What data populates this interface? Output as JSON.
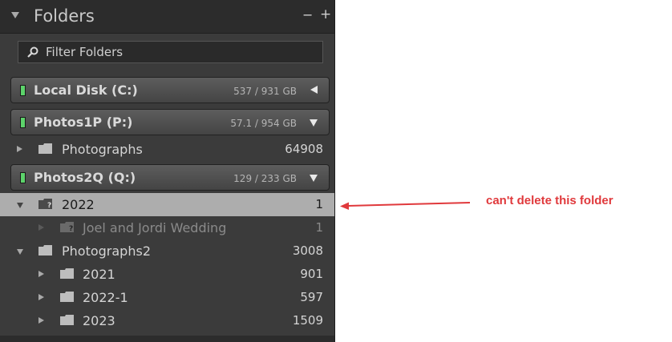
{
  "panel": {
    "title": "Folders",
    "minus_symbol": "−",
    "plus_symbol": "+",
    "filter_placeholder": "Filter Folders"
  },
  "volumes": [
    {
      "name": "Local Disk (C:)",
      "size": "537 / 931 GB",
      "led_color": "#5dd36b",
      "state": "collapsed"
    },
    {
      "name": "Photos1P (P:)",
      "size": "57.1 / 954 GB",
      "led_color": "#5dd36b",
      "state": "expanded"
    },
    {
      "name": "Photos2Q (Q:)",
      "size": "129 / 233 GB",
      "led_color": "#5dd36b",
      "state": "expanded"
    }
  ],
  "folders_p": [
    {
      "name": "Photographs",
      "count": "64908"
    }
  ],
  "folders_q": [
    {
      "name": "2022",
      "count": "1",
      "missing": true,
      "selected": true
    },
    {
      "name": "Joel and Jordi Wedding",
      "count": "1",
      "missing": true
    },
    {
      "name": "Photographs2",
      "count": "3008"
    },
    {
      "name": "2021",
      "count": "901"
    },
    {
      "name": "2022-1",
      "count": "597"
    },
    {
      "name": "2023",
      "count": "1509"
    }
  ],
  "annotation": {
    "text": "can't delete this folder",
    "color": "#e0393c"
  }
}
